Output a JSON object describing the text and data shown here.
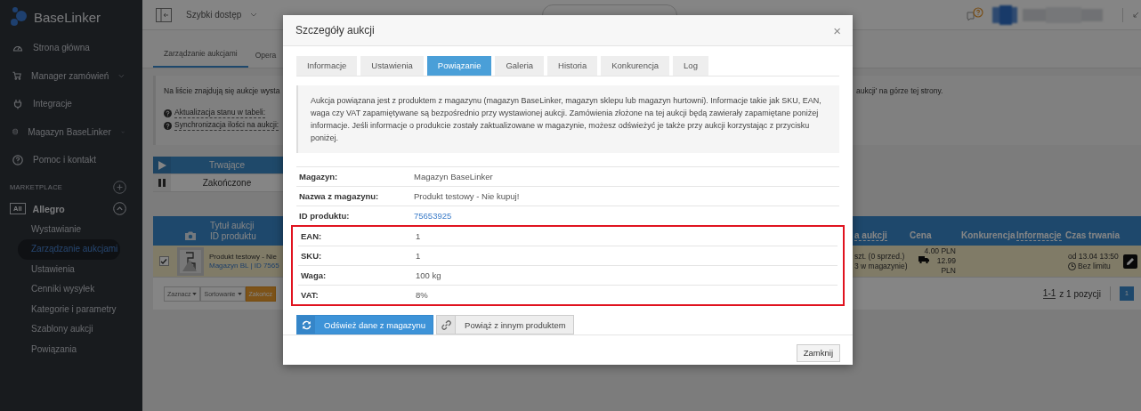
{
  "sidebar": {
    "logo": "BaseLinker",
    "items": [
      {
        "label": "Strona główna",
        "expandable": false
      },
      {
        "label": "Manager zamówień",
        "expandable": true
      },
      {
        "label": "Integracje",
        "expandable": false
      },
      {
        "label": "Magazyn BaseLinker",
        "expandable": true
      },
      {
        "label": "Pomoc i kontakt",
        "expandable": false
      }
    ],
    "marketplace": {
      "heading": "MARKETPLACE",
      "groups": [
        {
          "badge": "All",
          "label": "Allegro",
          "expanded": true,
          "children": [
            {
              "label": "Wystawianie",
              "selected": false
            },
            {
              "label": "Zarządzanie aukcjami",
              "selected": true
            },
            {
              "label": "Ustawienia",
              "selected": false
            },
            {
              "label": "Cenniki wysyłek",
              "selected": false
            },
            {
              "label": "Kategorie i parametry",
              "selected": false
            },
            {
              "label": "Szablony aukcji",
              "selected": false
            },
            {
              "label": "Powiązania",
              "selected": false
            }
          ]
        }
      ]
    }
  },
  "topbar": {
    "quick_access": "Szybki dostęp"
  },
  "page_tabs": [
    {
      "label": "Zarządzanie aukcjami",
      "selected": true
    },
    {
      "label": "Opera",
      "selected": false
    }
  ],
  "info_box": {
    "text_left": "Na liście znajdują się aukcje wysta",
    "text_right": "aukcji' na górze tej strony.",
    "help_links": [
      "Aktualizacja stanu w tabeli:",
      "Synchronizacja ilości na aukcji:"
    ]
  },
  "status_filters": [
    {
      "label": "Trwające",
      "selected": true
    },
    {
      "label": "Zakończone",
      "selected": false
    }
  ],
  "auctions_table": {
    "title_column": [
      "Tytuł aukcji",
      "ID produktu"
    ],
    "columns": [
      {
        "label": "a aukcji",
        "dashed": true
      },
      {
        "label": "Cena",
        "dashed": false
      },
      {
        "label": "Konkurencja",
        "dashed": false
      },
      {
        "label": "Informacje",
        "dashed": true
      },
      {
        "label": "Czas trwania",
        "dashed": false
      }
    ],
    "rows": [
      {
        "selected": true,
        "title": "Produkt testowy - Nie",
        "subtitle": "Magazyn BL | ID 7565",
        "quantity": [
          "szt. (0 sprzed.)",
          "3 w magazynie)"
        ],
        "price": "4.00 PLN",
        "shipping": "12.99 PLN",
        "start": "od 13.04 13:50",
        "duration": "Bez limitu"
      }
    ]
  },
  "toolbar": [
    {
      "label": "Zaznacz",
      "kind": "dropdown"
    },
    {
      "label": "Sortowanie",
      "kind": "dropdown"
    },
    {
      "label": "Zakończ",
      "kind": "warning"
    }
  ],
  "pagination": {
    "range": "1-1",
    "summary": "z 1 pozycji",
    "pages": [
      {
        "label": "1",
        "selected": true
      }
    ]
  },
  "modal": {
    "title": "Szczegóły aukcji",
    "close_icon": "×",
    "tabs": [
      {
        "label": "Informacje",
        "selected": false
      },
      {
        "label": "Ustawienia",
        "selected": false
      },
      {
        "label": "Powiązanie",
        "selected": true
      },
      {
        "label": "Galeria",
        "selected": false
      },
      {
        "label": "Historia",
        "selected": false
      },
      {
        "label": "Konkurencja",
        "selected": false
      },
      {
        "label": "Log",
        "selected": false
      }
    ],
    "notice": "Aukcja powiązana jest z produktem z magazynu (magazyn BaseLinker, magazyn sklepu lub magazyn hurtowni). Informacje takie jak SKU, EAN, waga czy VAT zapamiętywane są bezpośrednio przy wystawionej aukcji. Zamówienia złożone na tej aukcji będą zawierały zapamiętane poniżej informacje. Jeśli informacje o produkcie zostały zaktualizowane w magazynie, możesz odświeżyć je także przy aukcji korzystając z przycisku poniżej.",
    "details": [
      {
        "label": "Magazyn:",
        "value": "Magazyn BaseLinker",
        "kind": "text"
      },
      {
        "label": "Nazwa z magazynu:",
        "value": "Produkt testowy - Nie kupuj!",
        "kind": "text"
      },
      {
        "label": "ID produktu:",
        "value": "75653925",
        "kind": "link"
      }
    ],
    "highlighted_details": [
      {
        "label": "EAN:",
        "value": "1",
        "kind": "text"
      },
      {
        "label": "SKU:",
        "value": "1",
        "kind": "text"
      },
      {
        "label": "Waga:",
        "value": "100 kg",
        "kind": "text"
      },
      {
        "label": "VAT:",
        "value": "8%",
        "kind": "text"
      }
    ],
    "actions": [
      {
        "label": "Odśwież dane z magazynu",
        "kind": "primary"
      },
      {
        "label": "Powiąż z innym produktem",
        "kind": "default"
      }
    ],
    "footer_button": "Zamknij"
  }
}
